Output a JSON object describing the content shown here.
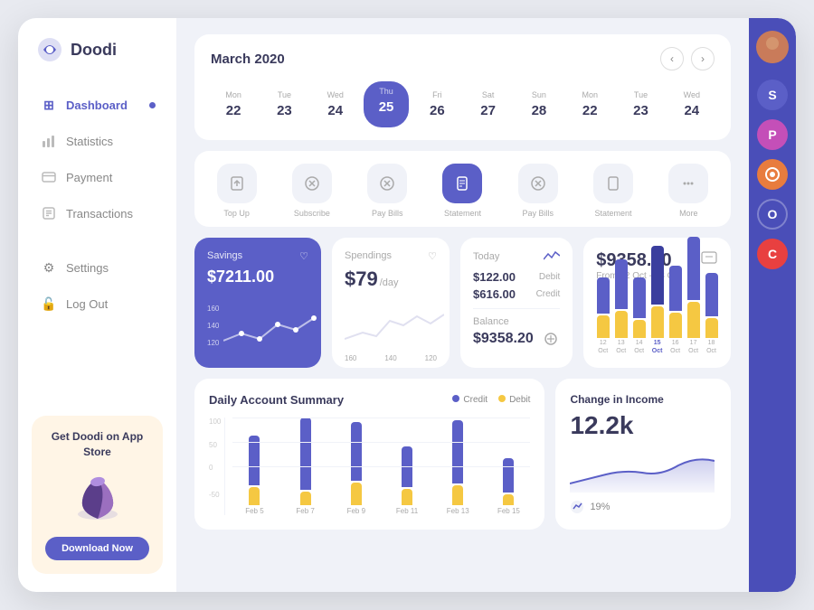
{
  "sidebar": {
    "logo": "Doodi",
    "nav_items": [
      {
        "label": "Dashboard",
        "icon": "⊞",
        "active": true
      },
      {
        "label": "Statistics",
        "icon": "📊",
        "active": false
      },
      {
        "label": "Payment",
        "icon": "💳",
        "active": false
      },
      {
        "label": "Transactions",
        "icon": "📁",
        "active": false
      }
    ],
    "settings_items": [
      {
        "label": "Settings",
        "icon": "⚙"
      },
      {
        "label": "Log Out",
        "icon": "🔓"
      }
    ],
    "promo": {
      "title": "Get Doodi on App Store",
      "button": "Download Now"
    }
  },
  "calendar": {
    "title": "March 2020",
    "days": [
      {
        "name": "Mon",
        "num": "22",
        "active": false
      },
      {
        "name": "Tue",
        "num": "23",
        "active": false
      },
      {
        "name": "Wed",
        "num": "24",
        "active": false
      },
      {
        "name": "Thu",
        "num": "25",
        "active": true
      },
      {
        "name": "Fri",
        "num": "26",
        "active": false
      },
      {
        "name": "Sat",
        "num": "27",
        "active": false
      },
      {
        "name": "Sun",
        "num": "28",
        "active": false
      },
      {
        "name": "Mon",
        "num": "22",
        "active": false
      },
      {
        "name": "Tue",
        "num": "23",
        "active": false
      },
      {
        "name": "Wed",
        "num": "24",
        "active": false
      }
    ]
  },
  "quick_actions": [
    {
      "label": "Top Up",
      "icon": "⬆",
      "active": false
    },
    {
      "label": "Subscribe",
      "icon": "⊗",
      "active": false
    },
    {
      "label": "Pay Bills",
      "icon": "⊗",
      "active": false
    },
    {
      "label": "Statement",
      "icon": "□",
      "active": true
    },
    {
      "label": "Pay Bills",
      "icon": "⊗",
      "active": false
    },
    {
      "label": "Statement",
      "icon": "□",
      "active": false
    },
    {
      "label": "More",
      "icon": "···",
      "active": false
    }
  ],
  "savings": {
    "title": "Savings",
    "amount": "$7211.00",
    "chart_labels": [
      "160",
      "140",
      "120"
    ]
  },
  "spendings": {
    "title": "Spendings",
    "amount": "$79",
    "per": "/day"
  },
  "today": {
    "title": "Today",
    "debit_amount": "$122.00",
    "debit_label": "Debit",
    "credit_amount": "$616.00",
    "credit_label": "Credit",
    "balance_label": "Balance",
    "balance_amount": "$9358.20"
  },
  "big_stat": {
    "amount": "$9358.20",
    "subtitle": "From 12 Oct - 18 Oct",
    "bars": [
      {
        "date": "12\nOct",
        "purple": 40,
        "yellow": 25
      },
      {
        "date": "13\nOct",
        "purple": 55,
        "yellow": 30
      },
      {
        "date": "14\nOct",
        "purple": 45,
        "yellow": 20
      },
      {
        "date": "15\nOct",
        "purple": 65,
        "yellow": 35,
        "active": true
      },
      {
        "date": "16\nOct",
        "purple": 50,
        "yellow": 28
      },
      {
        "date": "17\nOct",
        "purple": 70,
        "yellow": 40
      },
      {
        "date": "18\nOct",
        "purple": 48,
        "yellow": 22
      }
    ]
  },
  "daily_summary": {
    "title": "Daily Account Summary",
    "legend": [
      {
        "label": "Credit",
        "color": "#5b5fc7"
      },
      {
        "label": "Debit",
        "color": "#f5c842"
      }
    ],
    "chart_labels": [
      "100",
      "50",
      "0",
      "-50"
    ],
    "bars": [
      {
        "date": "Feb 5",
        "purple": 55,
        "yellow": 20
      },
      {
        "date": "Feb 7",
        "purple": 80,
        "yellow": 15
      },
      {
        "date": "Feb 9",
        "purple": 65,
        "yellow": 25
      },
      {
        "date": "Feb 11",
        "purple": 45,
        "yellow": 18
      },
      {
        "date": "Feb 13",
        "purple": 70,
        "yellow": 22
      },
      {
        "date": "Feb 15",
        "purple": 38,
        "yellow": 12
      }
    ]
  },
  "income": {
    "title": "Change in Income",
    "amount": "12.2k",
    "percent": "19%"
  },
  "right_panel": {
    "badges": [
      {
        "letter": "S",
        "color": "#5b5fc7"
      },
      {
        "letter": "P",
        "color": "#c44fb8"
      },
      {
        "letter": "O",
        "color": "#e87c3e"
      },
      {
        "letter": "O",
        "color": "#4a4eb8"
      },
      {
        "letter": "C",
        "color": "#e84040"
      }
    ]
  }
}
